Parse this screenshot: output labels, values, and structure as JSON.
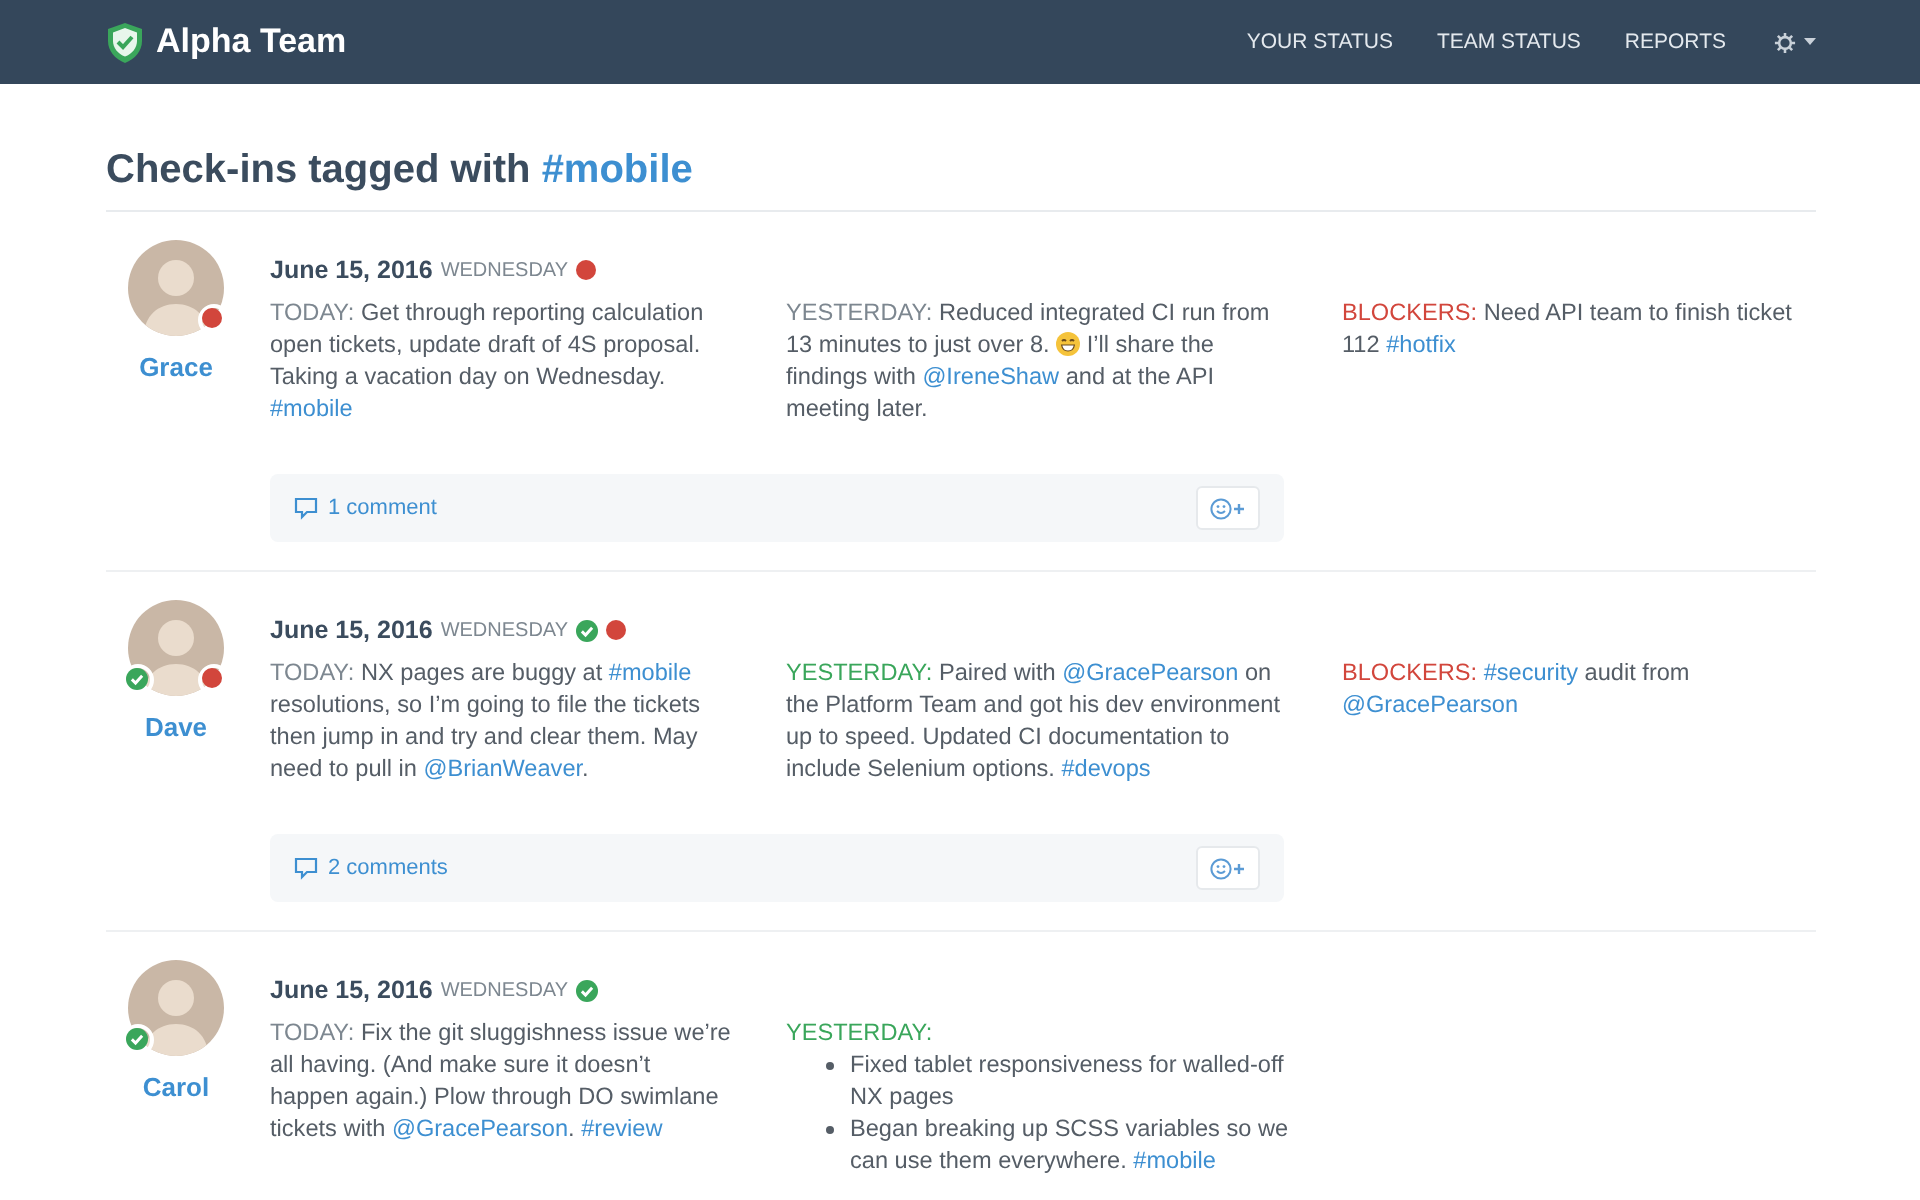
{
  "navbar": {
    "brand": "Alpha Team",
    "links": [
      "YOUR STATUS",
      "TEAM STATUS",
      "REPORTS"
    ]
  },
  "page": {
    "title": "Check-ins tagged with",
    "tag": "#mobile"
  },
  "checkins": [
    {
      "name": "Grace",
      "date": "June 15, 2016",
      "weekday": "WEDNESDAY",
      "checked_in": false,
      "blocked": true,
      "sections": [
        {
          "kind": "text",
          "color": "#7d8790",
          "label": "TODAY:",
          "parts": [
            {
              "kind": "text",
              "text": "Get through reporting calculation open tickets, update draft of 4S proposal. Taking a vacation day on Wednesday. "
            },
            {
              "kind": "link",
              "text": "#mobile"
            }
          ]
        },
        {
          "kind": "text",
          "color": "#7d8790",
          "label": "YESTERDAY:",
          "parts": [
            {
              "kind": "text",
              "text": "Reduced integrated CI run from 13 minutes to just over 8. "
            },
            {
              "kind": "emoji"
            },
            {
              "kind": "text",
              "text": " I’ll share the findings with "
            },
            {
              "kind": "link",
              "text": "@IreneShaw"
            },
            {
              "kind": "text",
              "text": " and at the API meeting later."
            }
          ]
        },
        {
          "kind": "text",
          "color": "#d2463c",
          "label": "BLOCKERS:",
          "parts": [
            {
              "kind": "text",
              "text": "Need API team to finish ticket 112 "
            },
            {
              "kind": "link",
              "text": "#hotfix"
            }
          ]
        }
      ],
      "comments": "1 comment"
    },
    {
      "name": "Dave",
      "date": "June 15, 2016",
      "weekday": "WEDNESDAY",
      "checked_in": true,
      "blocked": true,
      "sections": [
        {
          "kind": "text",
          "color": "#7d8790",
          "label": "TODAY:",
          "parts": [
            {
              "kind": "text",
              "text": "NX pages are buggy at "
            },
            {
              "kind": "link",
              "text": "#mobile"
            },
            {
              "kind": "text",
              "text": " resolutions, so I’m going to file the tickets then jump in and try and clear them. May need to pull in "
            },
            {
              "kind": "link",
              "text": "@BrianWeaver"
            },
            {
              "kind": "text",
              "text": "."
            }
          ]
        },
        {
          "kind": "text",
          "color": "#3aa65b",
          "label": "YESTERDAY:",
          "parts": [
            {
              "kind": "text",
              "text": "Paired with "
            },
            {
              "kind": "link",
              "text": "@GracePearson"
            },
            {
              "kind": "text",
              "text": " on the Platform Team and got his dev environment up to speed. Updated CI documentation to include Selenium options. "
            },
            {
              "kind": "link",
              "text": "#devops"
            }
          ]
        },
        {
          "kind": "text",
          "color": "#d2463c",
          "label": "BLOCKERS:",
          "parts": [
            {
              "kind": "link",
              "text": "#security"
            },
            {
              "kind": "text",
              "text": " audit from "
            },
            {
              "kind": "link",
              "text": "@GracePearson"
            }
          ]
        }
      ],
      "comments": "2 comments"
    },
    {
      "name": "Carol",
      "date": "June 15, 2016",
      "weekday": "WEDNESDAY",
      "checked_in": true,
      "blocked": false,
      "sections": [
        {
          "kind": "text",
          "color": "#7d8790",
          "label": "TODAY:",
          "parts": [
            {
              "kind": "text",
              "text": "Fix the git sluggishness issue we’re all having. (And make sure it doesn’t happen again.) Plow through DO swimlane tickets with "
            },
            {
              "kind": "link",
              "text": "@GracePearson"
            },
            {
              "kind": "text",
              "text": ". "
            },
            {
              "kind": "link",
              "text": "#review"
            }
          ]
        },
        {
          "kind": "list",
          "color": "#3aa65b",
          "label": "YESTERDAY:",
          "items": [
            [
              {
                "kind": "text",
                "text": "Fixed tablet responsiveness for walled-off NX pages"
              }
            ],
            [
              {
                "kind": "text",
                "text": "Began breaking up SCSS variables so we can use them everywhere. "
              },
              {
                "kind": "link",
                "text": "#mobile"
              }
            ]
          ]
        }
      ]
    }
  ]
}
